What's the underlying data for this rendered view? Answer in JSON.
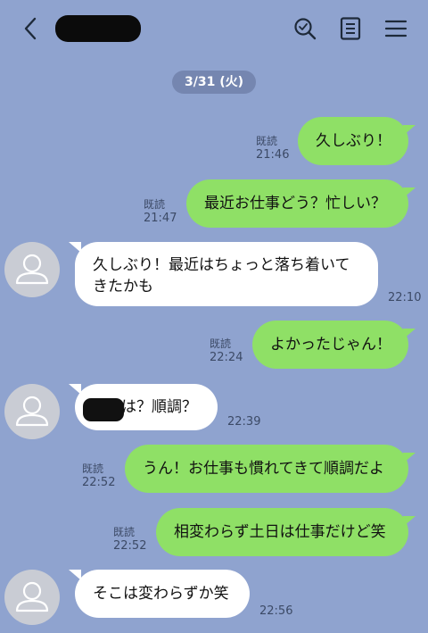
{
  "header": {
    "back_icon": "chevron-left-icon",
    "contact_name_redacted": true,
    "icons": [
      "search-icon",
      "note-icon",
      "menu-icon"
    ]
  },
  "date_label": "3/31 (火)",
  "read_label": "既読",
  "messages": [
    {
      "side": "right",
      "text": "久しぶり！",
      "read": "既読",
      "time": "21:46"
    },
    {
      "side": "right",
      "text": "最近お仕事どう？忙しい？",
      "read": "既読",
      "time": "21:47"
    },
    {
      "side": "left",
      "text": "久しぶり！最近はちょっと落ち着いてきたかも",
      "time": "22:10"
    },
    {
      "side": "right",
      "text": "よかったじゃん！",
      "read": "既読",
      "time": "22:24"
    },
    {
      "side": "left",
      "text": "は？順調？",
      "time": "22:39",
      "redacted_prefix": true
    },
    {
      "side": "right",
      "text": "うん！お仕事も慣れてきて順調だよ",
      "read": "既読",
      "time": "22:52"
    },
    {
      "side": "right",
      "text": "相変わらず土日は仕事だけど笑",
      "read": "既読",
      "time": "22:52"
    },
    {
      "side": "left",
      "text": "そこは変わらずか笑",
      "time": "22:56"
    }
  ],
  "colors": {
    "background": "#8fa3cf",
    "outgoing_bubble": "#8fe066",
    "incoming_bubble": "#ffffff",
    "date_pill": "#7586b0"
  }
}
